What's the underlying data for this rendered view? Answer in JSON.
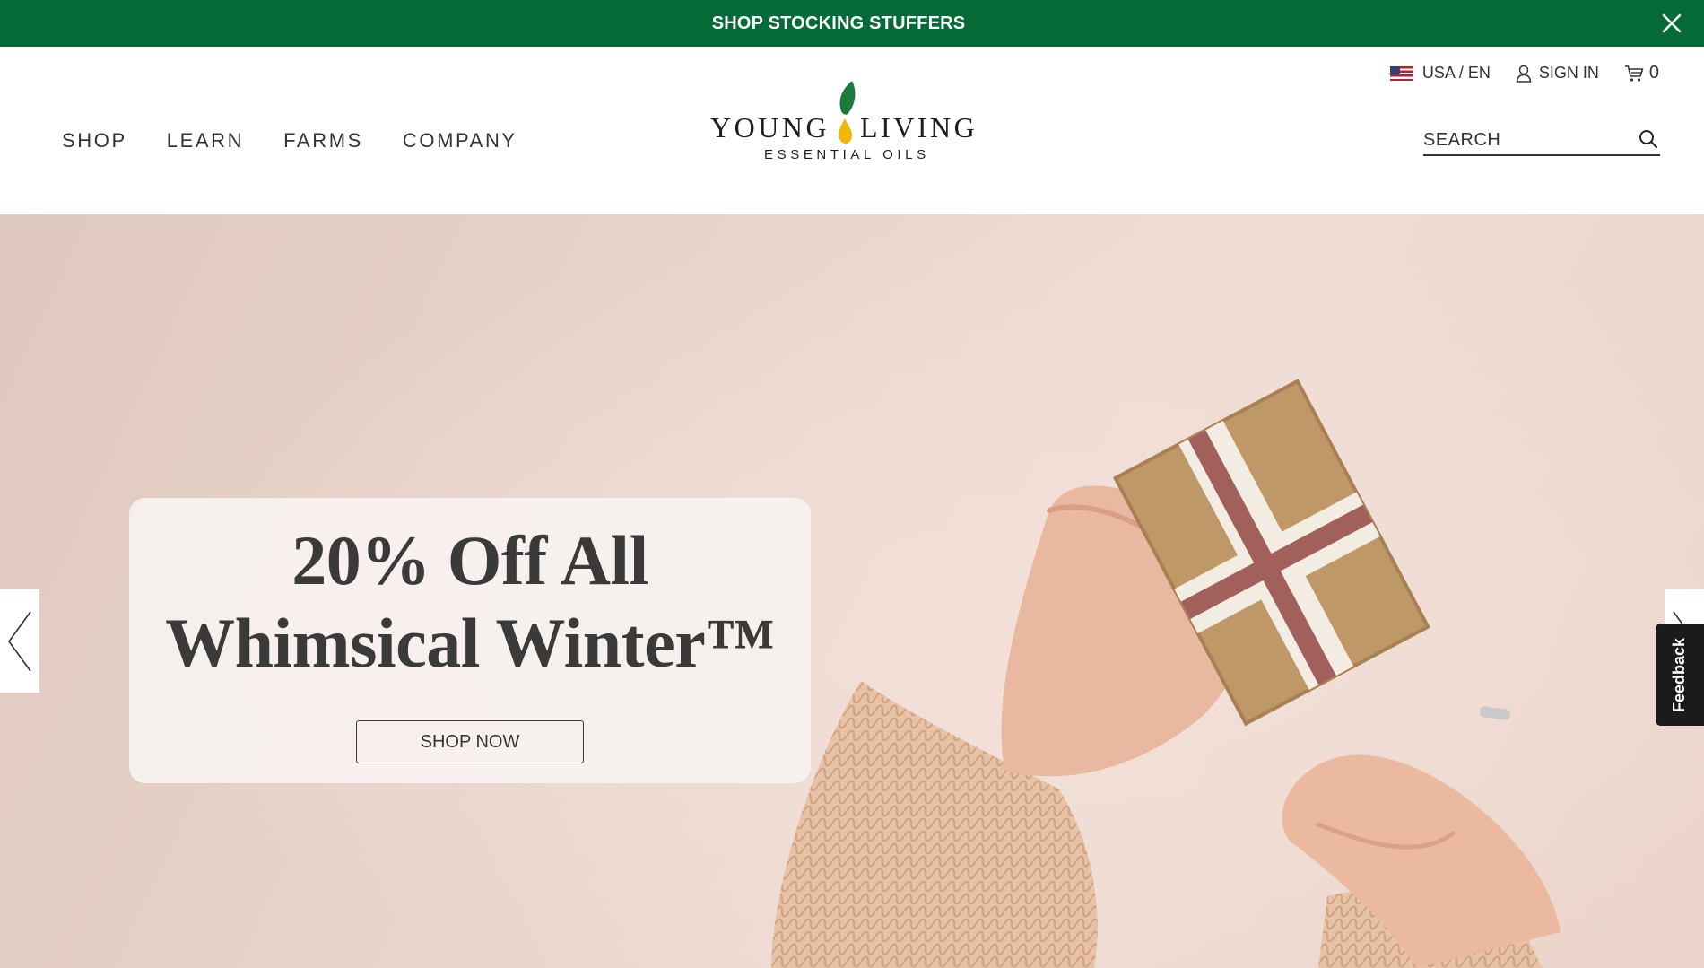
{
  "promo_bar": {
    "text": "SHOP STOCKING STUFFERS",
    "close_icon": "close-icon",
    "background": "#046a38"
  },
  "header": {
    "main_nav": [
      {
        "label": "SHOP"
      },
      {
        "label": "LEARN"
      },
      {
        "label": "FARMS"
      },
      {
        "label": "COMPANY"
      }
    ],
    "logo": {
      "word_left": "YOUNG",
      "word_right": "LIVING",
      "subtitle": "ESSENTIAL OILS",
      "leaf_color": "#1c7a3a",
      "drop_color": "#f2b705"
    },
    "utility": {
      "locale": "USA / EN",
      "locale_icon": "us-flag-icon",
      "sign_in": "SIGN IN",
      "sign_in_icon": "user-icon",
      "cart_icon": "cart-icon",
      "cart_count": "0"
    },
    "search": {
      "placeholder": "SEARCH",
      "value": "",
      "icon": "search-icon"
    }
  },
  "hero": {
    "title_line1": "20% Off All",
    "title_line2": "Whimsical Winter™",
    "cta_label": "SHOP NOW",
    "prev_icon": "chevron-left-icon",
    "next_icon": "chevron-right-icon",
    "image_subject": "hands-wrapping-gift-image"
  },
  "feedback": {
    "label": "Feedback"
  }
}
